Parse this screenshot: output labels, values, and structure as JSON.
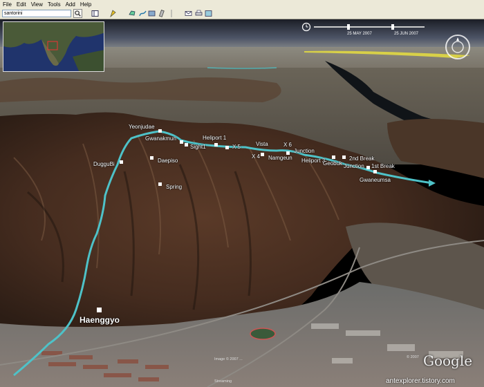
{
  "menu": [
    "File",
    "Edit",
    "View",
    "Tools",
    "Add",
    "Help"
  ],
  "search": {
    "value": "santorini"
  },
  "timeline": {
    "start": "25 MAY 2007",
    "end": "25 JUN 2007"
  },
  "labels": {
    "yeonjudae": "Yeonjudae",
    "gwanakmun": "Gwanakmun",
    "sight1": "Sight1",
    "heliport1": "Heliport 1",
    "x5": "X 5",
    "vista": "Vista",
    "x6": "X 6",
    "junction": "Junction",
    "x4": "X 4",
    "namgeun": "Namgeun",
    "heliport3": "Heliport 3",
    "geobuk": "Geobuk",
    "n2ndbreak": "2nd Break",
    "junction2": "Junction",
    "n1stbreak": "1st Break",
    "gwaneumsa": "Gwaneumsa",
    "duggubi": "DugguBi",
    "daepiso": "Daepiso",
    "spring": "Spring",
    "haenggyo": "Haenggyo"
  },
  "credits": {
    "line1": "Image © 2007 ...",
    "line2": "© 2007",
    "line3": "Streaming"
  },
  "brand": "Google",
  "watermark": "antexplorer.tistory.com"
}
